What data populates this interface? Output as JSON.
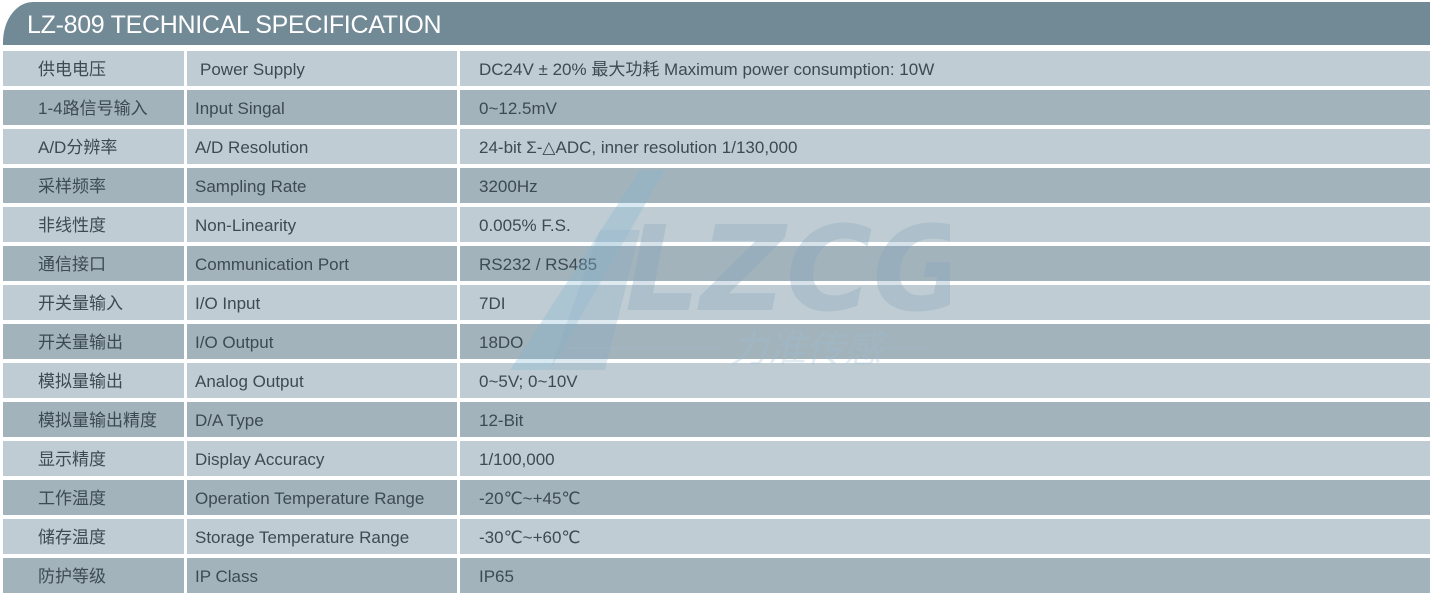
{
  "header": {
    "title": "LZ-809 TECHNICAL SPECIFICATION"
  },
  "watermark": {
    "logo_text": "LZCG",
    "subtitle": "力准传感"
  },
  "colors": {
    "header_bg": "#728a96",
    "row_light": "#bfccd3",
    "row_dark": "#a3b3bc",
    "text": "#3c4a52"
  },
  "rows": [
    {
      "cn": "供电电压",
      "en": "Power Supply",
      "value": "DC24V ± 20% 最大功耗 Maximum power consumption: 10W"
    },
    {
      "cn": "1-4路信号输入",
      "en": "Input Singal",
      "value": "0~12.5mV"
    },
    {
      "cn": "A/D分辨率",
      "en": "A/D Resolution",
      "value": "24-bit Σ-△ADC, inner resolution  1/130,000"
    },
    {
      "cn": "采样频率",
      "en": "Sampling Rate",
      "value": "3200Hz"
    },
    {
      "cn": "非线性度",
      "en": "Non-Linearity",
      "value": "0.005% F.S."
    },
    {
      "cn": "通信接口",
      "en": "Communication Port",
      "value": "RS232 / RS485"
    },
    {
      "cn": "开关量输入",
      "en": "I/O Input",
      "value": "7DI"
    },
    {
      "cn": "开关量输出",
      "en": "I/O Output",
      "value": "18DO"
    },
    {
      "cn": "模拟量输出",
      "en": "Analog Output",
      "value": "0~5V; 0~10V"
    },
    {
      "cn": "模拟量输出精度",
      "en": "D/A Type",
      "value": "12-Bit"
    },
    {
      "cn": "显示精度",
      "en": "Display Accuracy",
      "value": "1/100,000"
    },
    {
      "cn": "工作温度",
      "en": "Operation Temperature Range",
      "value": "-20℃~+45℃"
    },
    {
      "cn": "储存温度",
      "en": "Storage Temperature Range",
      "value": "-30℃~+60℃"
    },
    {
      "cn": "防护等级",
      "en": "IP Class",
      "value": "IP65"
    }
  ]
}
